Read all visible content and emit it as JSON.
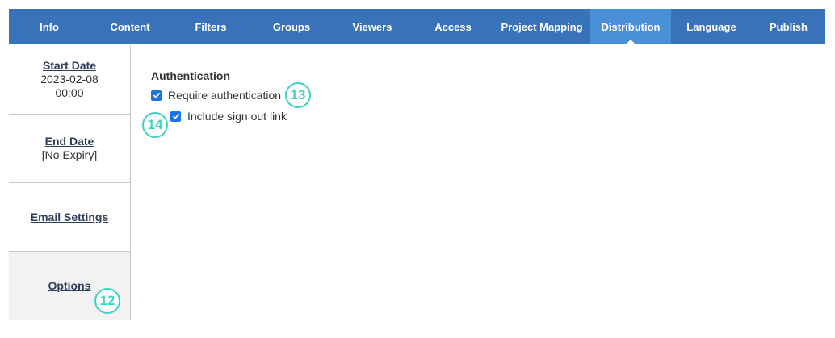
{
  "tabs": [
    {
      "label": "Info"
    },
    {
      "label": "Content"
    },
    {
      "label": "Filters"
    },
    {
      "label": "Groups"
    },
    {
      "label": "Viewers"
    },
    {
      "label": "Access"
    },
    {
      "label": "Project Mapping"
    },
    {
      "label": "Distribution",
      "active": true
    },
    {
      "label": "Language"
    },
    {
      "label": "Publish"
    }
  ],
  "sidebar": {
    "start_date": {
      "label": "Start Date",
      "value_date": "2023-02-08",
      "value_time": "00:00"
    },
    "end_date": {
      "label": "End Date",
      "value": "[No Expiry]"
    },
    "email_settings": {
      "label": "Email Settings"
    },
    "options": {
      "label": "Options"
    }
  },
  "main": {
    "section_title": "Authentication",
    "require_auth": {
      "label": "Require authentication",
      "checked": true
    },
    "sign_out_link": {
      "label": "Include sign out link",
      "checked": true
    }
  },
  "badges": {
    "options": "12",
    "require_auth": "13",
    "sign_out_link": "14"
  },
  "colors": {
    "tab_bar": "#3872b8",
    "tab_active": "#4a90d9",
    "checkbox": "#1a73e8",
    "badge": "#3fd4c2"
  }
}
